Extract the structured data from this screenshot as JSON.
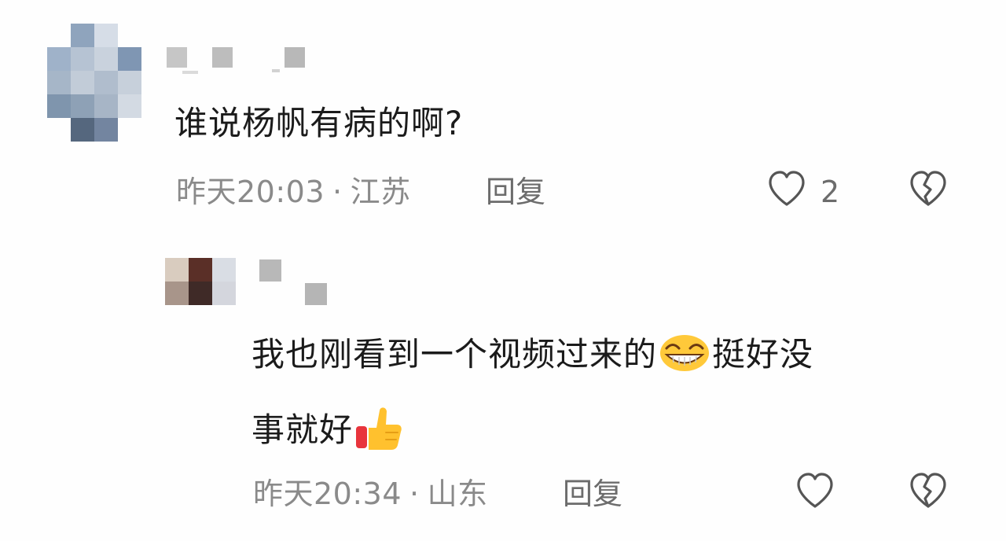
{
  "comments": [
    {
      "text": "谁说杨帆有病的啊?",
      "time": "昨天20:03",
      "separator": "·",
      "location": "江苏",
      "reply_label": "回复",
      "like_count": "2"
    },
    {
      "text_line1_a": "我也刚看到一个视频过来的",
      "text_line1_b": "挺好没",
      "text_line2": "事就好",
      "time": "昨天20:34",
      "separator": "·",
      "location": "山东",
      "reply_label": "回复"
    }
  ],
  "icons": {
    "like": "heart-outline-icon",
    "dislike": "broken-heart-icon",
    "grin_emoji": "grinning-face-emoji",
    "thumbs_emoji": "thumbs-up-emoji"
  },
  "colors": {
    "text": "#1b1b1b",
    "meta": "#8a8a8a",
    "icon": "#555555"
  }
}
